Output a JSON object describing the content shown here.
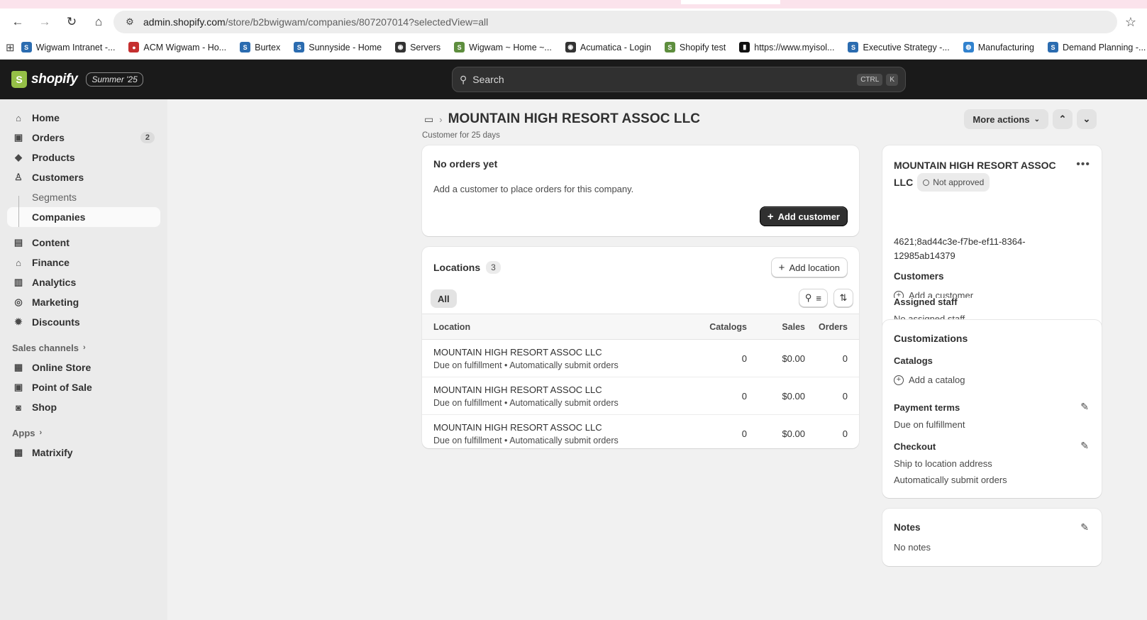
{
  "browser": {
    "url_host": "admin.shopify.com",
    "url_path": "/store/b2bwigwam/companies/807207014?selectedView=all",
    "bookmarks": [
      {
        "label": "Wigwam Intranet -...",
        "color": "#2b6cb0",
        "glyph": "S"
      },
      {
        "label": "ACM Wigwam - Ho...",
        "color": "#c53030",
        "glyph": "●"
      },
      {
        "label": "Burtex",
        "color": "#2b6cb0",
        "glyph": "S"
      },
      {
        "label": "Sunnyside - Home",
        "color": "#2b6cb0",
        "glyph": "S"
      },
      {
        "label": "Servers",
        "color": "#333333",
        "glyph": "◉"
      },
      {
        "label": "Wigwam ~ Home ~...",
        "color": "#5e8e3e",
        "glyph": "S"
      },
      {
        "label": "Acumatica - Login",
        "color": "#333333",
        "glyph": "◉"
      },
      {
        "label": "Shopify test",
        "color": "#5e8e3e",
        "glyph": "S"
      },
      {
        "label": "https://www.myisol...",
        "color": "#111111",
        "glyph": "▮"
      },
      {
        "label": "Executive Strategy -...",
        "color": "#2b6cb0",
        "glyph": "S"
      },
      {
        "label": "Manufacturing",
        "color": "#3182ce",
        "glyph": "◍"
      },
      {
        "label": "Demand Planning -...",
        "color": "#2b6cb0",
        "glyph": "S"
      }
    ]
  },
  "topbar": {
    "brand": "shopify",
    "edition": "Summer '25",
    "search_placeholder": "Search",
    "kbd1": "CTRL",
    "kbd2": "K"
  },
  "sidebar": {
    "home": "Home",
    "orders": "Orders",
    "orders_badge": "2",
    "products": "Products",
    "customers": "Customers",
    "segments": "Segments",
    "companies": "Companies",
    "content": "Content",
    "finance": "Finance",
    "analytics": "Analytics",
    "marketing": "Marketing",
    "discounts": "Discounts",
    "sales_channels": "Sales channels",
    "online_store": "Online Store",
    "point_of_sale": "Point of Sale",
    "shop": "Shop",
    "apps": "Apps",
    "matrixify": "Matrixify"
  },
  "page": {
    "title": "MOUNTAIN HIGH RESORT ASSOC LLC",
    "subtitle": "Customer for 25 days",
    "more_actions": "More actions"
  },
  "orders_card": {
    "heading": "No orders yet",
    "body": "Add a customer to place orders for this company.",
    "button": "Add customer"
  },
  "locations": {
    "heading": "Locations",
    "count": "3",
    "add_button": "Add location",
    "tab_all": "All",
    "columns": {
      "location": "Location",
      "catalogs": "Catalogs",
      "sales": "Sales",
      "orders": "Orders"
    },
    "rows": [
      {
        "name": "MOUNTAIN HIGH RESORT ASSOC LLC",
        "meta": "Due on fulfillment • Automatically submit orders",
        "catalogs": "0",
        "sales": "$0.00",
        "orders": "0"
      },
      {
        "name": "MOUNTAIN HIGH RESORT ASSOC LLC",
        "meta": "Due on fulfillment • Automatically submit orders",
        "catalogs": "0",
        "sales": "$0.00",
        "orders": "0"
      },
      {
        "name": "MOUNTAIN HIGH RESORT ASSOC LLC",
        "meta": "Due on fulfillment • Automatically submit orders",
        "catalogs": "0",
        "sales": "$0.00",
        "orders": "0"
      }
    ]
  },
  "company_card": {
    "name_line1": "MOUNTAIN HIGH RESORT ASSOC",
    "name_line2": "LLC",
    "status": "Not approved",
    "id_line1": "4621;8ad44c3e-f7be-ef11-8364-",
    "id_line2": "12985ab14379",
    "customers_label": "Customers",
    "add_customer": "Add a customer",
    "staff_label": "Assigned staff",
    "staff_value": "No assigned staff"
  },
  "custom_card": {
    "heading": "Customizations",
    "catalogs_label": "Catalogs",
    "add_catalog": "Add a catalog",
    "payment_label": "Payment terms",
    "payment_value": "Due on fulfillment",
    "checkout_label": "Checkout",
    "checkout_value1": "Ship to location address",
    "checkout_value2": "Automatically submit orders"
  },
  "notes_card": {
    "heading": "Notes",
    "value": "No notes"
  }
}
